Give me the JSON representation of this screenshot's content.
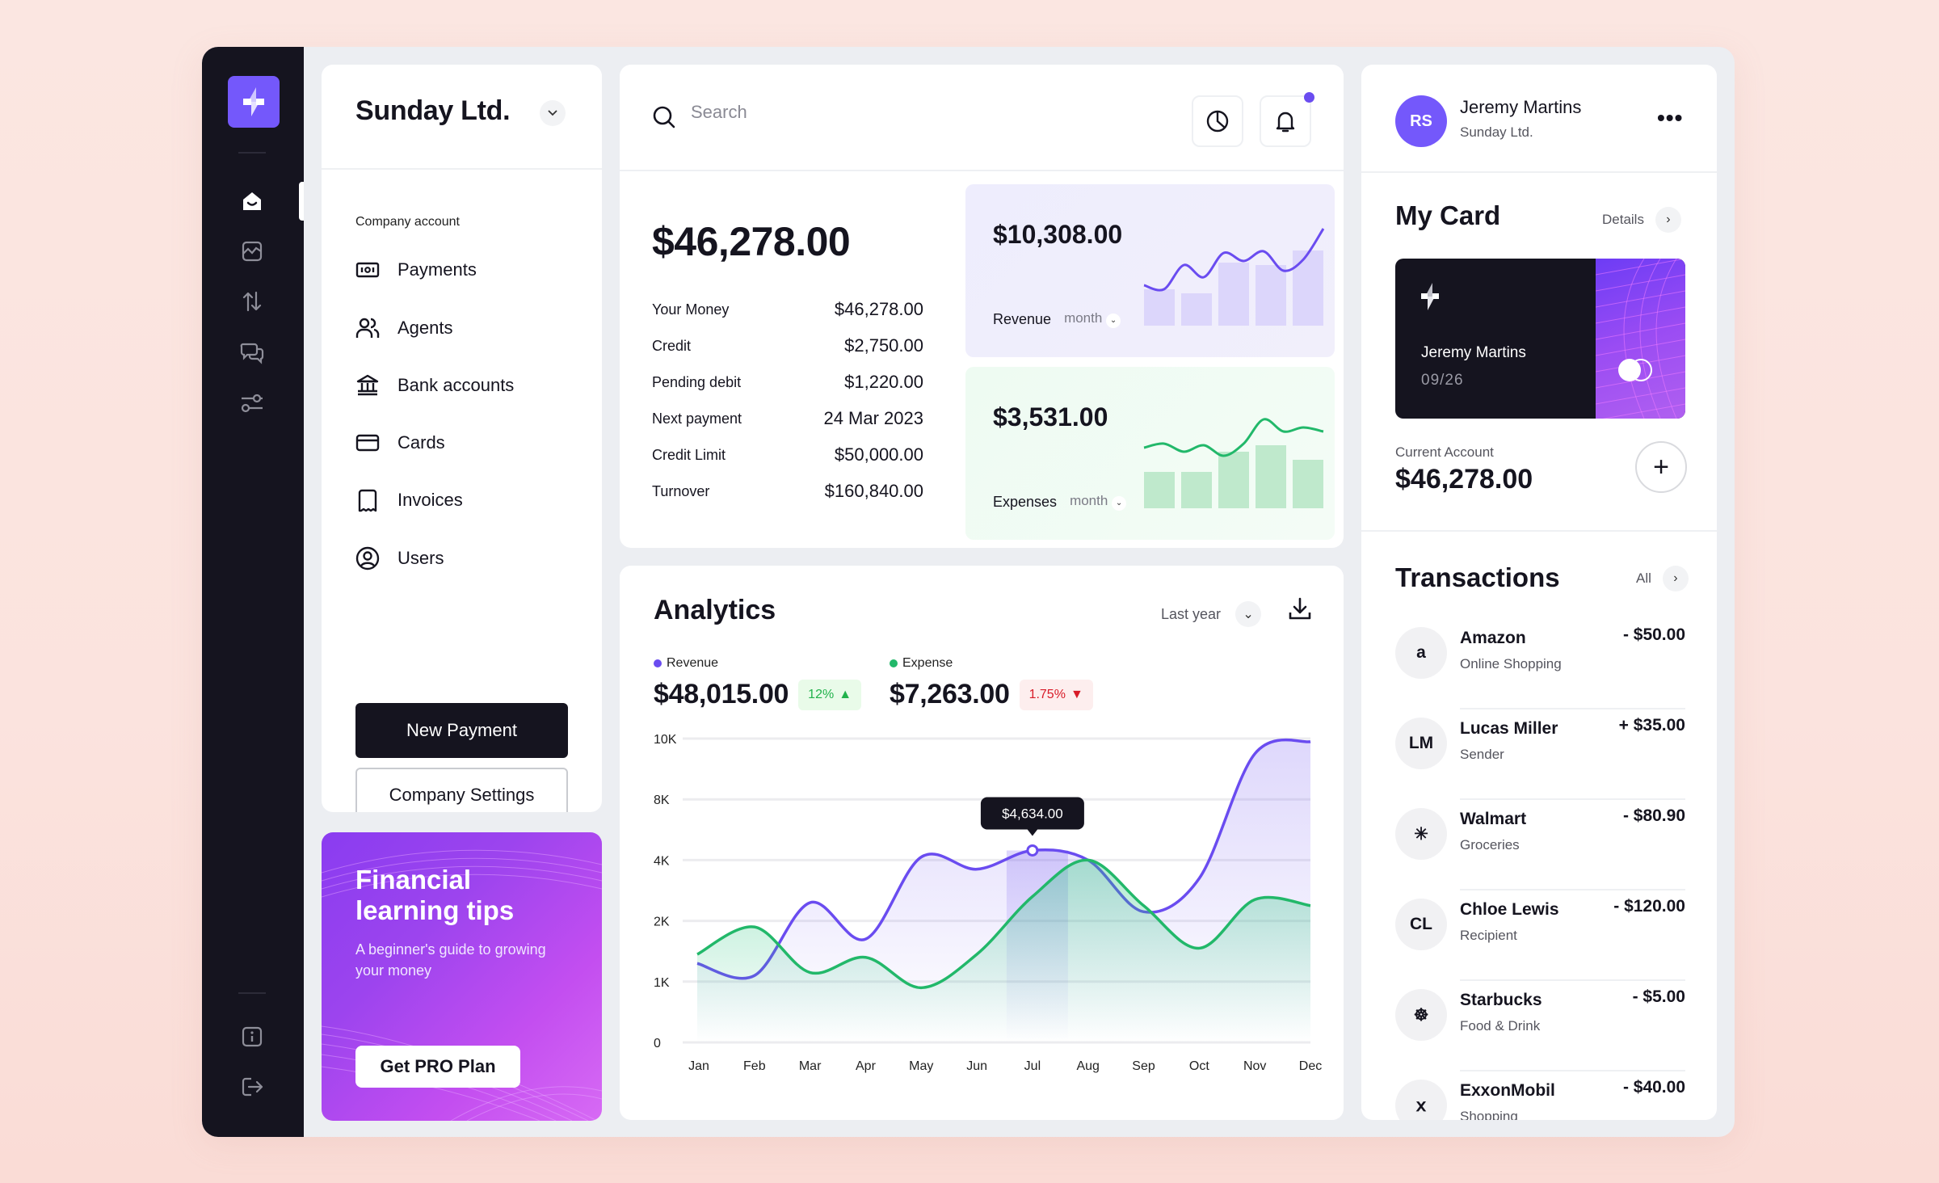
{
  "sidebar": {
    "items": [
      {
        "name": "home",
        "active": true
      },
      {
        "name": "analytics"
      },
      {
        "name": "transfers"
      },
      {
        "name": "messages"
      },
      {
        "name": "settings"
      }
    ],
    "bottom_items": [
      {
        "name": "info"
      },
      {
        "name": "logout"
      }
    ]
  },
  "company_panel": {
    "title": "Sunday Ltd.",
    "section_label": "Company account",
    "items": [
      {
        "label": "Payments",
        "icon": "payments-icon"
      },
      {
        "label": "Agents",
        "icon": "agents-icon"
      },
      {
        "label": "Bank accounts",
        "icon": "bank-icon"
      },
      {
        "label": "Cards",
        "icon": "card-icon"
      },
      {
        "label": "Invoices",
        "icon": "invoice-icon"
      },
      {
        "label": "Users",
        "icon": "user-icon"
      }
    ],
    "new_payment_label": "New Payment",
    "company_settings_label": "Company Settings"
  },
  "promo": {
    "title": "Financial learning tips",
    "subtitle": "A beginner's guide to growing your money",
    "button_label": "Get PRO Plan"
  },
  "search": {
    "placeholder": "Search",
    "value": ""
  },
  "overview": {
    "balance": "$46,278.00",
    "rows": [
      {
        "label": "Your Money",
        "value": "$46,278.00"
      },
      {
        "label": "Credit",
        "value": "$2,750.00"
      },
      {
        "label": "Pending debit",
        "value": "$1,220.00"
      },
      {
        "label": "Next payment",
        "value": "24 Mar 2023"
      },
      {
        "label": "Credit Limit",
        "value": "$50,000.00"
      },
      {
        "label": "Turnover",
        "value": "$160,840.00"
      }
    ],
    "revenue_card": {
      "value": "$10,308.00",
      "label": "Revenue",
      "period": "month",
      "color": "#6a4cf0"
    },
    "expenses_card": {
      "value": "$3,531.00",
      "label": "Expenses",
      "period": "month",
      "color": "#22b86a"
    }
  },
  "analytics": {
    "title": "Analytics",
    "period": "Last year",
    "revenue": {
      "label": "Revenue",
      "value": "$48,015.00",
      "change": "12%",
      "direction": "up",
      "color": "#6a4cf0"
    },
    "expense": {
      "label": "Expense",
      "value": "$7,263.00",
      "change": "1.75%",
      "direction": "down",
      "color": "#22b86a"
    },
    "tooltip": "$4,634.00"
  },
  "chart_data": {
    "type": "line",
    "title": "Analytics",
    "categories": [
      "Jan",
      "Feb",
      "Mar",
      "Apr",
      "May",
      "Jun",
      "Jul",
      "Aug",
      "Sep",
      "Oct",
      "Nov",
      "Dec"
    ],
    "y_ticks": [
      "0",
      "1K",
      "2K",
      "4K",
      "8K",
      "10K"
    ],
    "y_tick_values": [
      0,
      1000,
      2000,
      4000,
      8000,
      10000
    ],
    "ylim": [
      0,
      10000
    ],
    "grid": true,
    "series": [
      {
        "name": "Revenue",
        "color": "#6a4cf0",
        "values": [
          1300,
          1100,
          2600,
          1700,
          4200,
          3700,
          4634,
          4000,
          2300,
          3400,
          9500,
          9900
        ]
      },
      {
        "name": "Expense",
        "color": "#22b86a",
        "values": [
          1450,
          1900,
          1150,
          1400,
          900,
          1450,
          2800,
          4000,
          2500,
          1550,
          2700,
          2500
        ]
      }
    ],
    "highlight": {
      "category": "Jul",
      "series": "Revenue",
      "label": "$4,634.00"
    }
  },
  "mini_charts": {
    "revenue": {
      "bars": [
        0.45,
        0.4,
        0.78,
        0.75,
        0.93
      ],
      "line": [
        0.3,
        0.25,
        0.55,
        0.4,
        0.7,
        0.6,
        0.72,
        0.48,
        0.62,
        1.0
      ]
    },
    "expenses": {
      "bars": [
        0.45,
        0.45,
        0.7,
        0.78,
        0.6
      ],
      "line": [
        0.55,
        0.6,
        0.5,
        0.58,
        0.45,
        0.6,
        0.9,
        0.75,
        0.8,
        0.75
      ]
    }
  },
  "profile": {
    "initials": "RS",
    "name": "Jeremy Martins",
    "company": "Sunday Ltd."
  },
  "my_card": {
    "title": "My Card",
    "details_label": "Details",
    "holder": "Jeremy Martins",
    "expiry": "09/26",
    "account_label": "Current Account",
    "account_value": "$46,278.00"
  },
  "transactions": {
    "title": "Transactions",
    "all_label": "All",
    "items": [
      {
        "logo": "a",
        "name": "Amazon",
        "category": "Online Shopping",
        "amount": "- $50.00"
      },
      {
        "logo": "LM",
        "name": "Lucas Miller",
        "category": "Sender",
        "amount": "+ $35.00"
      },
      {
        "logo": "✳",
        "name": "Walmart",
        "category": "Groceries",
        "amount": "- $80.90"
      },
      {
        "logo": "CL",
        "name": "Chloe Lewis",
        "category": "Recipient",
        "amount": "- $120.00"
      },
      {
        "logo": "☸",
        "name": "Starbucks",
        "category": "Food & Drink",
        "amount": "- $5.00"
      },
      {
        "logo": "ⅹ",
        "name": "ExxonMobil",
        "category": "Shopping",
        "amount": "- $40.00"
      }
    ]
  }
}
